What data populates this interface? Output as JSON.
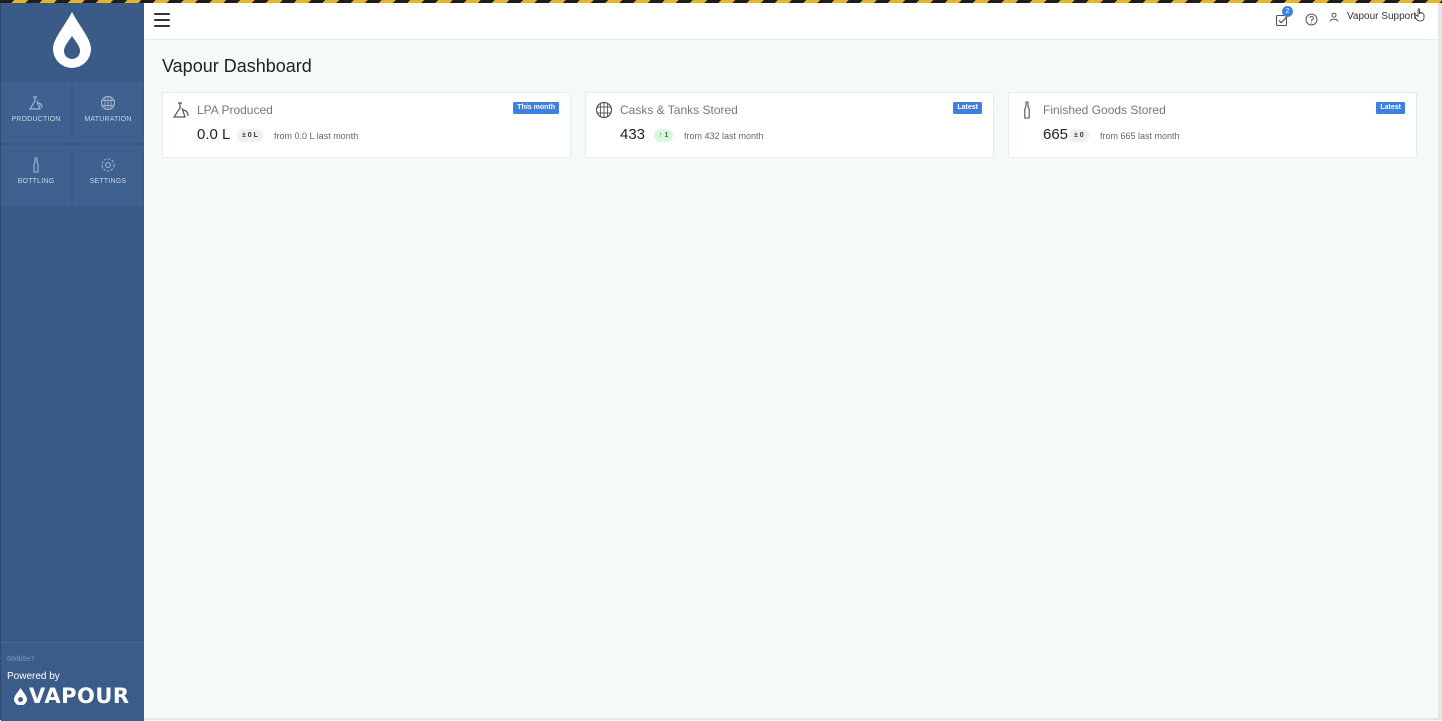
{
  "sidebar": {
    "nav": [
      {
        "label": "PRODUCTION",
        "icon": "still-icon"
      },
      {
        "label": "MATURATION",
        "icon": "barrel-icon"
      },
      {
        "label": "BOTTLING",
        "icon": "bottle-icon"
      },
      {
        "label": "SETTINGS",
        "icon": "gear-icon"
      }
    ],
    "version": "68db5e7",
    "powered_by": "Powered by",
    "brand": "VAPOUR"
  },
  "header": {
    "menu_icon": "hamburger-icon",
    "task_count": "2",
    "user_name": "Vapour Support"
  },
  "main": {
    "title": "Vapour Dashboard",
    "cards": [
      {
        "title": "LPA Produced",
        "tag": "This month",
        "value": "0.0 L",
        "delta": "± 0 L",
        "from": "from 0.0 L last month",
        "trend": "flat"
      },
      {
        "title": "Casks & Tanks Stored",
        "tag": "Latest",
        "value": "433",
        "delta": "↑ 1",
        "from": "from 432 last month",
        "trend": "up"
      },
      {
        "title": "Finished Goods Stored",
        "tag": "Latest",
        "value": "665",
        "delta": "± 0",
        "from": "from 665 last month",
        "trend": "flat"
      }
    ]
  },
  "colors": {
    "sidebar": "#3a5b88",
    "accent": "#3f7fe0",
    "background": "#f4faf8",
    "positive": "#2f7a45"
  }
}
